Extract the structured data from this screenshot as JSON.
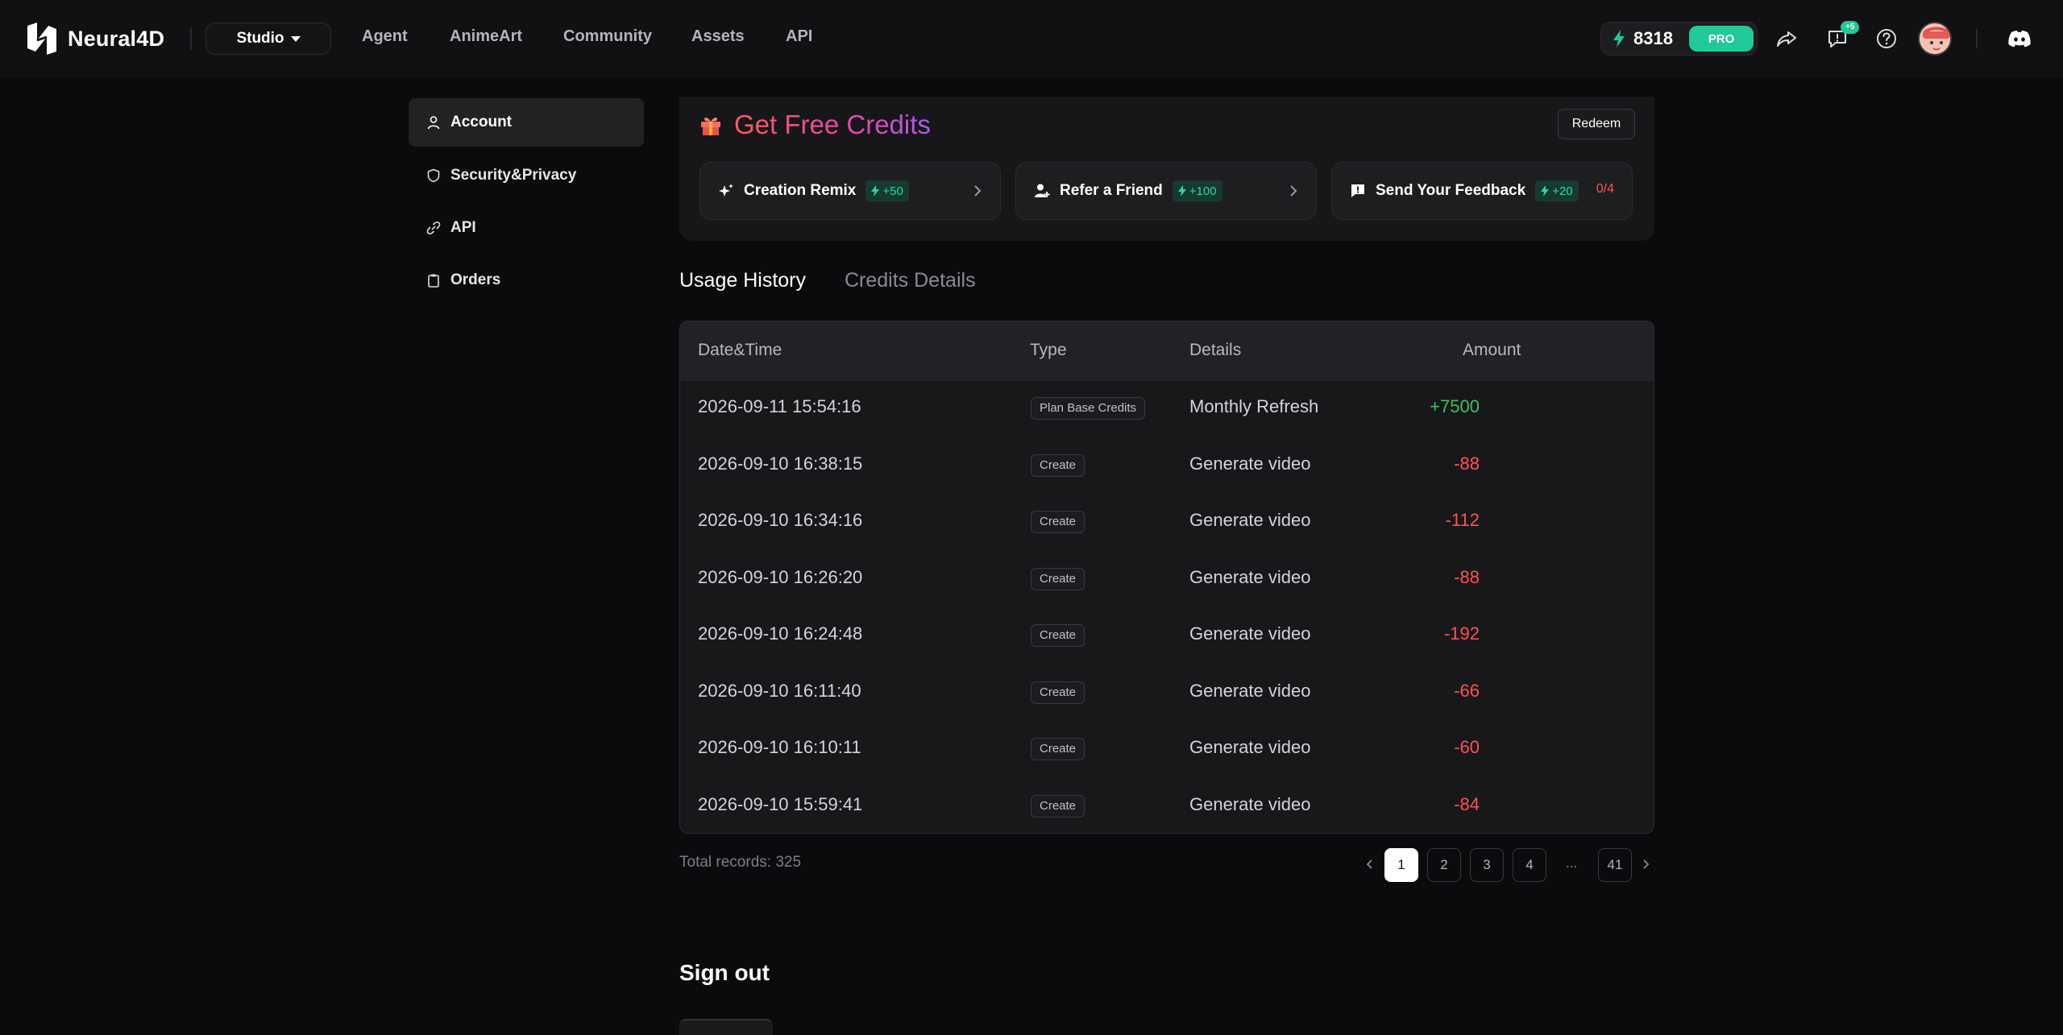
{
  "app": {
    "brand": "Neural4D",
    "studio_label": "Studio",
    "nav": [
      {
        "label": "Agent"
      },
      {
        "label": "AnimeArt"
      },
      {
        "label": "Community"
      },
      {
        "label": "Assets"
      },
      {
        "label": "API"
      }
    ],
    "credits_balance": "8318",
    "plan_badge": "PRO",
    "notification_badge": "+5"
  },
  "sidebar": {
    "items": [
      {
        "label": "Account",
        "icon": "user-icon",
        "active": true
      },
      {
        "label": "Security&Privacy",
        "icon": "shield-icon",
        "active": false
      },
      {
        "label": "API",
        "icon": "link-icon",
        "active": false
      },
      {
        "label": "Orders",
        "icon": "clipboard-icon",
        "active": false
      }
    ]
  },
  "free_credits": {
    "title": "Get Free Credits",
    "redeem_label": "Redeem",
    "tasks": [
      {
        "label": "Creation Remix",
        "reward": "+50",
        "icon": "sparkle-icon"
      },
      {
        "label": "Refer a Friend",
        "reward": "+100",
        "icon": "user-plus-icon"
      },
      {
        "label": "Send Your Feedback",
        "reward": "+20",
        "progress": "0/4",
        "icon": "feedback-icon"
      }
    ]
  },
  "tabs": [
    {
      "label": "Usage History",
      "active": true
    },
    {
      "label": "Credits Details",
      "active": false
    }
  ],
  "table": {
    "columns": [
      "Date&Time",
      "Type",
      "Details",
      "Amount"
    ],
    "rows": [
      {
        "datetime": "2026-09-11 15:54:16",
        "type": "Plan Base Credits",
        "details": "Monthly Refresh",
        "amount": "+7500"
      },
      {
        "datetime": "2026-09-10 16:38:15",
        "type": "Create",
        "details": "Generate video",
        "amount": "-88"
      },
      {
        "datetime": "2026-09-10 16:34:16",
        "type": "Create",
        "details": "Generate video",
        "amount": "-112"
      },
      {
        "datetime": "2026-09-10 16:26:20",
        "type": "Create",
        "details": "Generate video",
        "amount": "-88"
      },
      {
        "datetime": "2026-09-10 16:24:48",
        "type": "Create",
        "details": "Generate video",
        "amount": "-192"
      },
      {
        "datetime": "2026-09-10 16:11:40",
        "type": "Create",
        "details": "Generate video",
        "amount": "-66"
      },
      {
        "datetime": "2026-09-10 16:10:11",
        "type": "Create",
        "details": "Generate video",
        "amount": "-60"
      },
      {
        "datetime": "2026-09-10 15:59:41",
        "type": "Create",
        "details": "Generate video",
        "amount": "-84"
      }
    ]
  },
  "pagination": {
    "total_label": "Total records: 325",
    "pages": [
      "1",
      "2",
      "3",
      "4"
    ],
    "ellipsis": "...",
    "last_page": "41",
    "current": "1"
  },
  "signout": {
    "title": "Sign out"
  },
  "colors": {
    "accent": "#20c997",
    "positive": "#3fbf5f",
    "negative": "#ff5252"
  }
}
